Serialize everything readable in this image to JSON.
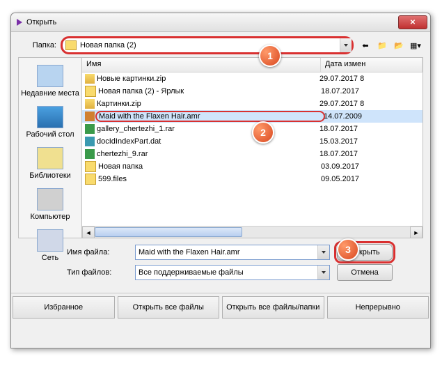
{
  "window": {
    "title": "Открыть",
    "close": "✕"
  },
  "folder": {
    "label": "Папка:",
    "value": "Новая папка (2)"
  },
  "places": [
    {
      "label": "Недавние места",
      "key": "recent"
    },
    {
      "label": "Рабочий стол",
      "key": "desktop"
    },
    {
      "label": "Библиотеки",
      "key": "libraries"
    },
    {
      "label": "Компьютер",
      "key": "computer"
    },
    {
      "label": "Сеть",
      "key": "network"
    }
  ],
  "columns": {
    "name": "Имя",
    "date": "Дата измен"
  },
  "files": [
    {
      "name": "Новые картинки.zip",
      "date": "29.07.2017 8",
      "icon": "zip"
    },
    {
      "name": "Новая папка (2) - Ярлык",
      "date": "18.07.2017",
      "icon": "fold"
    },
    {
      "name": "Картинки.zip",
      "date": "29.07.2017 8",
      "icon": "zip"
    },
    {
      "name": "Maid with the Flaxen Hair.amr",
      "date": "14.07.2009",
      "icon": "amr",
      "selected": true
    },
    {
      "name": "gallery_chertezhi_1.rar",
      "date": "18.07.2017",
      "icon": "rar"
    },
    {
      "name": "docIdIndexPart.dat",
      "date": "15.03.2017",
      "icon": "dat"
    },
    {
      "name": "chertezhi_9.rar",
      "date": "18.07.2017",
      "icon": "rar"
    },
    {
      "name": "Новая папка",
      "date": "03.09.2017",
      "icon": "fold"
    },
    {
      "name": "599.files",
      "date": "09.05.2017",
      "icon": "fold"
    }
  ],
  "filename": {
    "label": "Имя файла:",
    "value": "Maid with the Flaxen Hair.amr"
  },
  "filetype": {
    "label": "Тип файлов:",
    "value": "Все поддерживаемые файлы"
  },
  "buttons": {
    "open": "Открыть",
    "cancel": "Отмена"
  },
  "bottom_buttons": [
    "Избранное",
    "Открыть все файлы",
    "Открыть все файлы/папки",
    "Непрерывно"
  ],
  "badges": [
    "1",
    "2",
    "3"
  ]
}
